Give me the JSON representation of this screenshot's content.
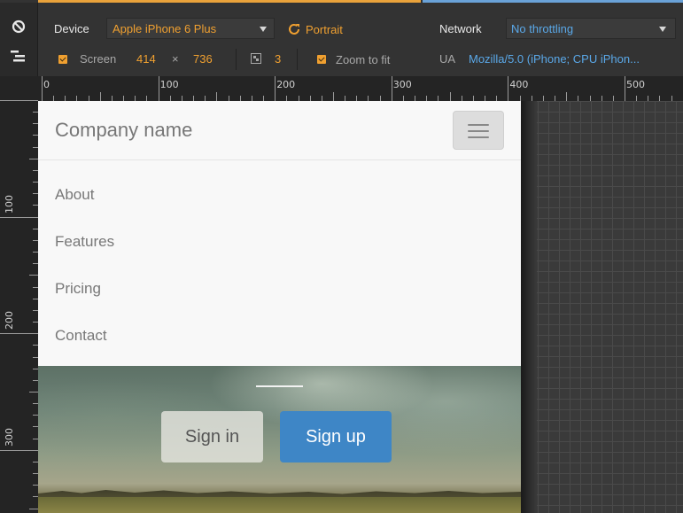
{
  "toolbar": {
    "device_label": "Device",
    "device_value": "Apple iPhone 6 Plus",
    "orientation_label": "Portrait",
    "network_label": "Network",
    "network_value": "No throttling",
    "screen_label": "Screen",
    "screen_width": "414",
    "screen_times": "×",
    "screen_height": "736",
    "pixel_ratio": "3",
    "zoom_label": "Zoom to fit",
    "ua_label": "UA",
    "ua_value": "Mozilla/5.0 (iPhone; CPU iPhon..."
  },
  "rulers": {
    "top": [
      "0",
      "100",
      "200",
      "300",
      "400",
      "500"
    ],
    "left": [
      "100",
      "200",
      "300"
    ]
  },
  "page": {
    "brand": "Company name",
    "menu": [
      "About",
      "Features",
      "Pricing",
      "Contact"
    ],
    "signin": "Sign in",
    "signup": "Sign up"
  },
  "colors": {
    "accent_orange": "#f0a030",
    "accent_blue": "#5aa8e8",
    "signup_blue": "#3e86c6"
  }
}
